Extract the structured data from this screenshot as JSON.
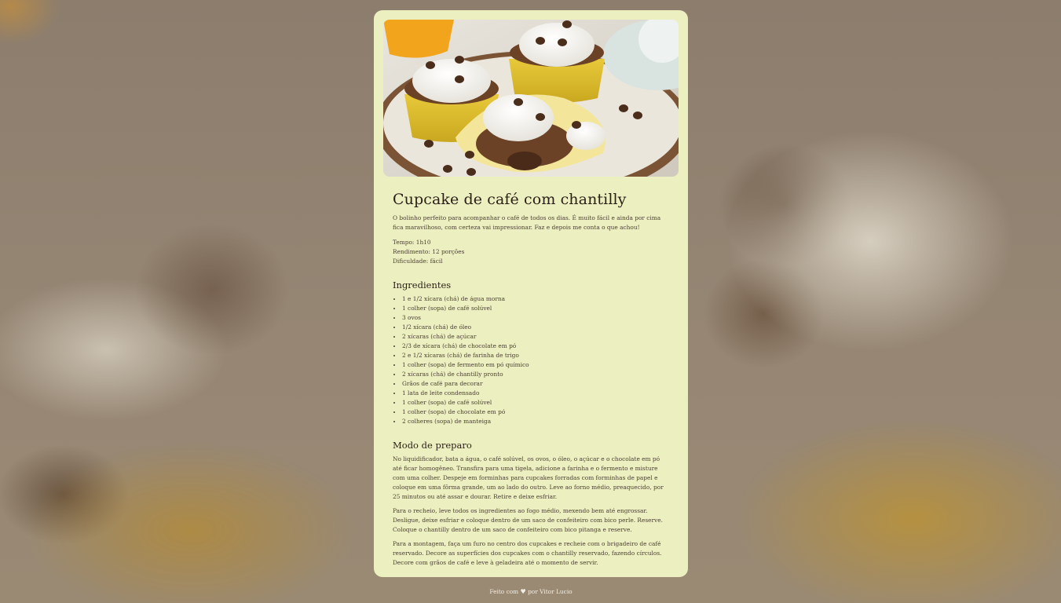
{
  "recipe": {
    "title": "Cupcake de café com chantilly",
    "intro": "O bolinho perfeito para acompanhar o café de todos os dias. É muito fácil e ainda por cima fica maravilhoso, com certeza vai impressionar. Faz e depois me conta o que achou!",
    "meta": {
      "time": "Tempo: 1h10",
      "yield": "Rendimento: 12 porções",
      "difficulty": "Dificuldade: fácil"
    },
    "ingredients_title": "Ingredientes",
    "ingredients": [
      "1 e 1/2 xícara (chá) de água morna",
      "1 colher (sopa) de café solúvel",
      "3 ovos",
      "1/2 xícara (chá) de óleo",
      "2 xícaras (chá) de açúcar",
      "2/3 de xícara (chá) de chocolate em pó",
      "2 e 1/2 xícaras (chá) de farinha de trigo",
      "1 colher (sopa) de fermento em pó químico",
      "2 xícaras (chá) de chantilly pronto",
      "Grãos de café para decorar",
      "1 lata de leite condensado",
      "1 colher (sopa) de café solúvel",
      "1 colher (sopa) de chocolate em pó",
      "2 colheres (sopa) de manteiga"
    ],
    "steps_title": "Modo de preparo",
    "steps": [
      "No liquidificador, bata a água, o café solúvel, os ovos, o óleo, o açúcar e o chocolate em pó até ficar homogêneo. Transfira para uma tigela, adicione a farinha e o fermento e misture com uma colher. Despeje em forminhas para cupcakes forradas com forminhas de papel e coloque em uma fôrma grande, um ao lado do outro. Leve ao forno médio, preaquecido, por 25 minutos ou até assar e dourar. Retire e deixe esfriar.",
      "Para o recheio, leve todos os ingredientes ao fogo médio, mexendo bem até engrossar. Desligue, deixe esfriar e coloque dentro de um saco de confeiteiro com bico perle. Reserve. Coloque o chantilly dentro de um saco de confeiteiro com bico pitanga e reserve.",
      "Para a montagem, faça um furo no centro dos cupcakes e recheie com o brigadeiro de café reservado. Decore as superfícies dos cupcakes com o chantilly reservado, fazendo círculos. Decore com grãos de café e leve à geladeira até o momento de servir."
    ]
  },
  "footer": {
    "made_with": "Feito com",
    "heart_icon": "heart-icon",
    "by": "por Vitor Lucio"
  },
  "colors": {
    "card_background": "#ecefbf",
    "text": "#4a3f35",
    "heading": "#2a1f18"
  }
}
